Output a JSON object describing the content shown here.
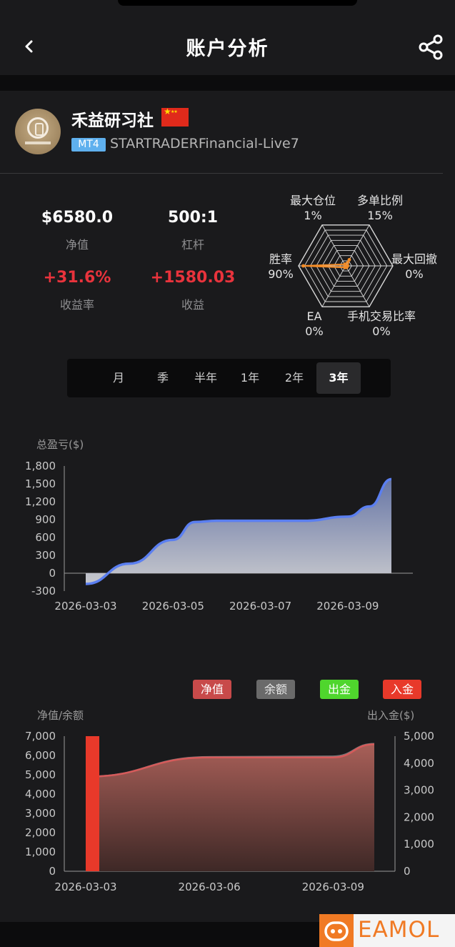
{
  "header": {
    "title": "账户分析"
  },
  "profile": {
    "name": "禾益研习社",
    "platform_badge": "MT4",
    "server": "STARTRADERFinancial-Live7"
  },
  "stats": {
    "equity": {
      "value": "$6580.0",
      "label": "净值"
    },
    "leverage": {
      "value": "500:1",
      "label": "杠杆"
    },
    "return_rate": {
      "value": "+31.6%",
      "label": "收益率"
    },
    "profit": {
      "value": "+1580.03",
      "label": "收益"
    }
  },
  "radar": {
    "labels": [
      {
        "name": "最大仓位",
        "value": "1%"
      },
      {
        "name": "多单比例",
        "value": "15%"
      },
      {
        "name": "最大回撤",
        "value": "0%"
      },
      {
        "name": "手机交易比率",
        "value": "0%"
      },
      {
        "name": "EA",
        "value": "0%"
      },
      {
        "name": "胜率",
        "value": "90%"
      }
    ],
    "fractions": [
      0.01,
      0.15,
      0.0,
      0.0,
      0.0,
      0.9
    ],
    "accent_color": "#f28c28"
  },
  "periods": {
    "items": [
      "月",
      "季",
      "半年",
      "1年",
      "2年",
      "3年"
    ],
    "selected": "3年"
  },
  "chart_data": [
    {
      "type": "area",
      "ylabel": "总盈亏($)",
      "ylim": [
        -300,
        1800
      ],
      "yticks": [
        "1,800",
        "1,500",
        "1,200",
        "900",
        "600",
        "300",
        "0",
        "-300"
      ],
      "xticks": [
        "2026-03-03",
        "2026-03-05",
        "2026-03-07",
        "2026-03-09"
      ],
      "x": [
        "2026-03-03",
        "2026-03-04",
        "2026-03-05",
        "2026-03-05T12",
        "2026-03-06",
        "2026-03-07",
        "2026-03-08",
        "2026-03-09",
        "2026-03-09T12",
        "2026-03-10"
      ],
      "values": [
        -180,
        160,
        560,
        860,
        880,
        880,
        880,
        950,
        1120,
        1580
      ],
      "line_color": "#5b7ff0"
    },
    {
      "type": "area",
      "ylabel": "净值/余额",
      "y2label": "出入金($)",
      "ylim": [
        0,
        7000
      ],
      "y2lim": [
        0,
        5000
      ],
      "yticks": [
        "7,000",
        "6,000",
        "5,000",
        "4,000",
        "3,000",
        "2,000",
        "1,000",
        "0"
      ],
      "y2ticks": [
        "5,000",
        "4,000",
        "3,000",
        "2,000",
        "1,000",
        "0"
      ],
      "xticks": [
        "2026-03-03",
        "2026-03-06",
        "2026-03-09"
      ],
      "legend": [
        "净值",
        "余额",
        "出金",
        "入金"
      ],
      "series": [
        {
          "name": "净值",
          "x": [
            "2026-03-03",
            "2026-03-06",
            "2026-03-09",
            "2026-03-10"
          ],
          "values": [
            4900,
            5900,
            5900,
            6580
          ]
        },
        {
          "name": "余额",
          "x": [
            "2026-03-03",
            "2026-03-06",
            "2026-03-09",
            "2026-03-10"
          ],
          "values": [
            4900,
            5920,
            5950,
            6600
          ]
        },
        {
          "name": "入金",
          "x": [
            "2026-03-03"
          ],
          "values": [
            5000
          ]
        }
      ],
      "colors": {
        "equity": "#d65a5a",
        "balance": "#777777",
        "withdraw": "#4fd62d",
        "deposit": "#e8392a"
      }
    }
  ],
  "watermark": "EAMOL"
}
